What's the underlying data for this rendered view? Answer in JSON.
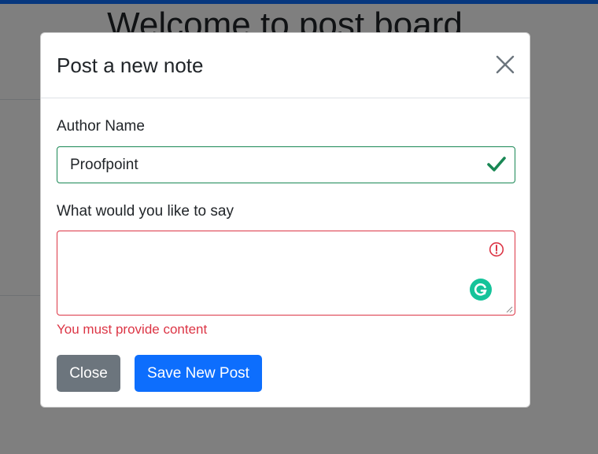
{
  "page": {
    "title": "Welcome to post board"
  },
  "modal": {
    "title": "Post a new note",
    "close_icon": "close-icon",
    "author": {
      "label": "Author Name",
      "value": "Proofpoint",
      "state_icon": "checkmark-icon",
      "state_color": "#198754"
    },
    "content": {
      "label": "What would you like to say",
      "value": "",
      "state_icon": "exclamation-circle-icon",
      "state_color": "#dc3545",
      "extension_icon": "grammarly-icon",
      "feedback": "You must provide content"
    },
    "buttons": {
      "close_label": "Close",
      "save_label": "Save New Post"
    }
  },
  "colors": {
    "primary": "#0d6efd",
    "secondary": "#6c757d",
    "valid": "#198754",
    "invalid": "#dc3545",
    "grammarly": "#15c39a"
  }
}
